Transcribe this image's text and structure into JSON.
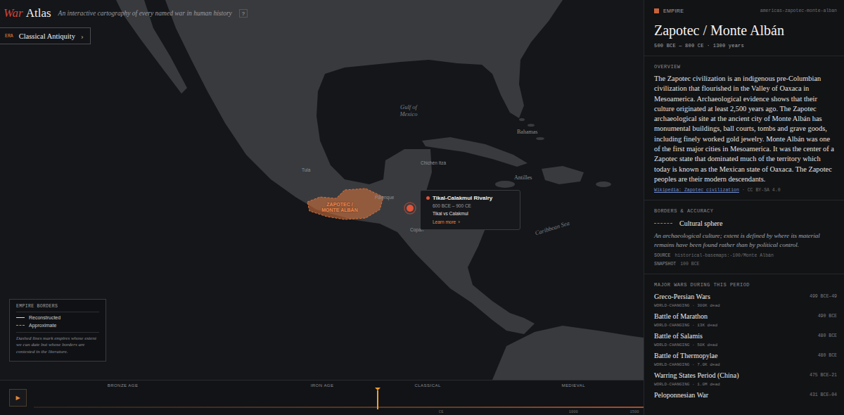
{
  "header": {
    "logo_accent": "War",
    "logo_rest": "Atlas",
    "subtitle": "An interactive cartography of every named war in human history",
    "help": "?"
  },
  "era": {
    "label": "ERA",
    "value": "Classical Antiquity",
    "chevron": "›"
  },
  "map": {
    "labels": [
      {
        "text": "Gulf of Mexico",
        "kind": "water"
      },
      {
        "text": "Bahamas",
        "kind": "region"
      },
      {
        "text": "Antilles",
        "kind": "region"
      },
      {
        "text": "Caribbean Sea",
        "kind": "water"
      },
      {
        "text": "Tula",
        "kind": "place"
      },
      {
        "text": "Palenque",
        "kind": "place"
      },
      {
        "text": "Chichén Itzá",
        "kind": "place"
      },
      {
        "text": "Copán",
        "kind": "place"
      }
    ],
    "empire": {
      "label": "ZAPOTEC / MONTE ALBÁN",
      "selected": true
    },
    "tooltip": {
      "title": "Tikal-Calakmul Rivalry",
      "dates": "600 BCE – 900 CE",
      "versus": "Tikal vs Calakmul",
      "cta": "Learn more",
      "cta_icon": "›"
    }
  },
  "legend": {
    "title": "EMPIRE BORDERS",
    "items": [
      {
        "label": "Reconstructed",
        "kind": "solid"
      },
      {
        "label": "Approximate",
        "kind": "dashed"
      }
    ],
    "note": "Dashed lines mark empires whose extent we can date but whose borders are contested in the literature."
  },
  "timeline": {
    "play": "▶",
    "eras": [
      "BRONZE AGE",
      "IRON AGE",
      "CLASSICAL",
      "MEDIEVAL"
    ],
    "ticks": [
      "CE",
      "1000",
      "1500"
    ],
    "cursor_level": 0.564
  },
  "panel": {
    "kind_label": "EMPIRE",
    "id": "americas-zapotec-monte-alban",
    "title": "Zapotec / Monte Albán",
    "dates": "500 BCE — 800 CE · 1300 years",
    "overview_label": "OVERVIEW",
    "overview": "The Zapotec civilization is an indigenous pre-Columbian civilization that flourished in the Valley of Oaxaca in Mesoamerica. Archaeological evidence shows that their culture originated at least 2,500 years ago. The Zapotec archaeological site at the ancient city of Monte Albán has monumental buildings, ball courts, tombs and grave goods, including finely worked gold jewelry. Monte Albán was one of the first major cities in Mesoamerica. It was the center of a Zapotec state that dominated much of the territory which today is known as the Mexican state of Oaxaca. The Zapotec peoples are their modern descendants.",
    "link": "Wikipedia: Zapotec civilization",
    "license": "· CC BY-SA 4.0",
    "borders_label": "BORDERS & ACCURACY",
    "border_type": "Cultural sphere",
    "border_desc": "An archaeological culture; extent is defined by where its material remains have been found rather than by political control.",
    "source_label": "SOURCE",
    "source": "historical-basemaps:-100/Monte Albán",
    "snapshot_label": "SNAPSHOT",
    "snapshot": "100 BCE",
    "wars_label": "MAJOR WARS DURING THIS PERIOD",
    "wars": [
      {
        "name": "Greco-Persian Wars",
        "meta": "WORLD-CHANGING · 300K dead",
        "date": "499 BCE–49"
      },
      {
        "name": "Battle of Marathon",
        "meta": "WORLD-CHANGING · 13K dead",
        "date": "490 BCE"
      },
      {
        "name": "Battle of Salamis",
        "meta": "WORLD-CHANGING · 50K dead",
        "date": "480 BCE"
      },
      {
        "name": "Battle of Thermopylae",
        "meta": "WORLD-CHANGING · 7.0K dead",
        "date": "480 BCE"
      },
      {
        "name": "Warring States Period (China)",
        "meta": "WORLD-CHANGING · 1.0M dead",
        "date": "475 BCE–21"
      },
      {
        "name": "Peloponnesian War",
        "date": "431 BCE–04"
      }
    ]
  }
}
